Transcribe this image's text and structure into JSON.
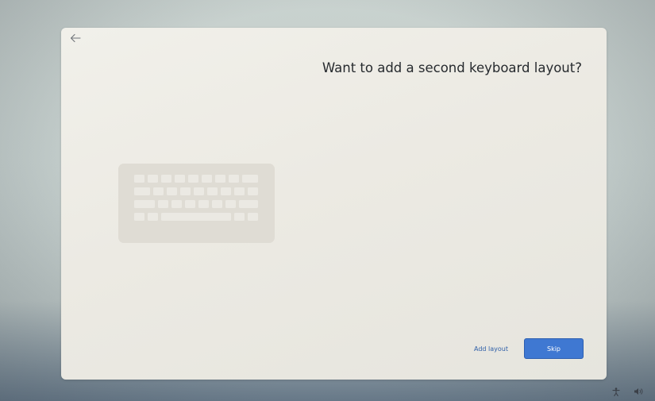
{
  "window": {
    "title": "Want to add a second keyboard layout?"
  },
  "icons": {
    "back": "arrow-left-icon",
    "illustration": "keyboard-illustration-icon",
    "tray_accessibility": "accessibility-icon",
    "tray_volume": "volume-icon"
  },
  "actions": {
    "add_layout_label": "Add layout",
    "skip_label": "Skip"
  },
  "colors": {
    "accent": "#3f78d2",
    "link": "#2f5fa8",
    "card_bg": "#eceae3",
    "title_text": "#262a2e"
  }
}
